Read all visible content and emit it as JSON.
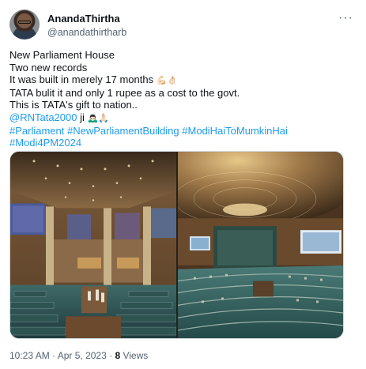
{
  "author": {
    "display_name": "AnandaThirtha",
    "handle": "@anandathirtharb"
  },
  "more_icon": "more-horizontal-icon",
  "tweet": {
    "lines": [
      "New Parliament House",
      "Two new records",
      "It was built in merely 17 months"
    ],
    "line3_emojis": "💪🏻👌🏻",
    "line4": "TATA bulit it and only 1 rupee as a cost to the govt.",
    "line5": "This is TATA's gift to nation..",
    "mention": "@RNTata2000",
    "mention_suffix": " ji",
    "mention_emojis": "🙇🏻‍♂️🙏🏻",
    "hashtags_line1": [
      "#Parliament",
      "#NewParliamentBuilding",
      "#ModiHaiToMumkinHai"
    ],
    "hashtags_line2": [
      "#Modi4PM2024"
    ]
  },
  "meta": {
    "time": "10:23 AM",
    "separator": " · ",
    "date": "Apr 5, 2023",
    "views_count": "8",
    "views_label": " Views"
  },
  "colors": {
    "link": "#1d9bf0",
    "secondary_text": "#536471"
  }
}
